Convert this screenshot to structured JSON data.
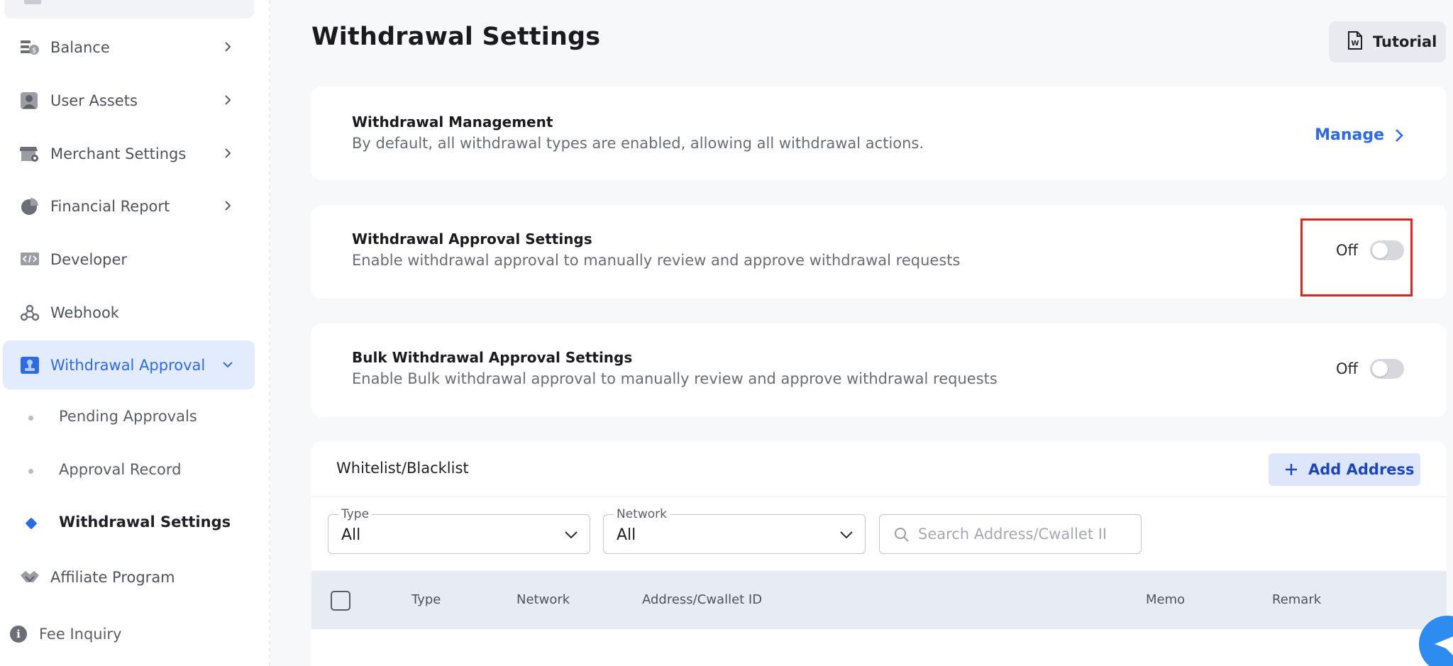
{
  "sidebar": {
    "items": [
      {
        "label": "Balance",
        "icon": "balance-icon"
      },
      {
        "label": "User Assets",
        "icon": "user-assets-icon"
      },
      {
        "label": "Merchant Settings",
        "icon": "store-settings-icon"
      },
      {
        "label": "Financial Report",
        "icon": "pie-chart-icon"
      },
      {
        "label": "Developer",
        "icon": "code-icon"
      },
      {
        "label": "Webhook",
        "icon": "webhook-icon"
      },
      {
        "label": "Withdrawal Approval",
        "icon": "approval-stamp-icon"
      },
      {
        "label": "Affiliate Program",
        "icon": "handshake-icon"
      }
    ],
    "sub_items": [
      {
        "label": "Pending Approvals"
      },
      {
        "label": "Approval Record"
      },
      {
        "label": "Withdrawal Settings"
      }
    ],
    "fee_inquiry": {
      "label": "Fee Inquiry",
      "icon": "info-icon"
    }
  },
  "page": {
    "title": "Withdrawal Settings",
    "tutorial_label": "Tutorial"
  },
  "cards": {
    "management": {
      "title": "Withdrawal Management",
      "desc": "By default, all withdrawal types are enabled, allowing all withdrawal actions.",
      "action": "Manage"
    },
    "approval": {
      "title": "Withdrawal Approval Settings",
      "desc": "Enable withdrawal approval to manually review and approve withdrawal requests",
      "state": "Off"
    },
    "bulk": {
      "title": "Bulk Withdrawal Approval Settings",
      "desc": "Enable Bulk withdrawal approval to manually review and approve withdrawal requests",
      "state": "Off"
    }
  },
  "whitelist": {
    "title": "Whitelist/Blacklist",
    "add_label": "Add Address",
    "filters": {
      "type": {
        "label": "Type",
        "value": "All"
      },
      "network": {
        "label": "Network",
        "value": "All"
      },
      "search_placeholder": "Search Address/Cwallet II"
    },
    "columns": [
      "Type",
      "Network",
      "Address/Cwallet ID",
      "Memo",
      "Remark"
    ]
  },
  "colors": {
    "accent": "#2e6ae6",
    "highlight": "#e0231c",
    "table_header": "#e7ebf3"
  }
}
